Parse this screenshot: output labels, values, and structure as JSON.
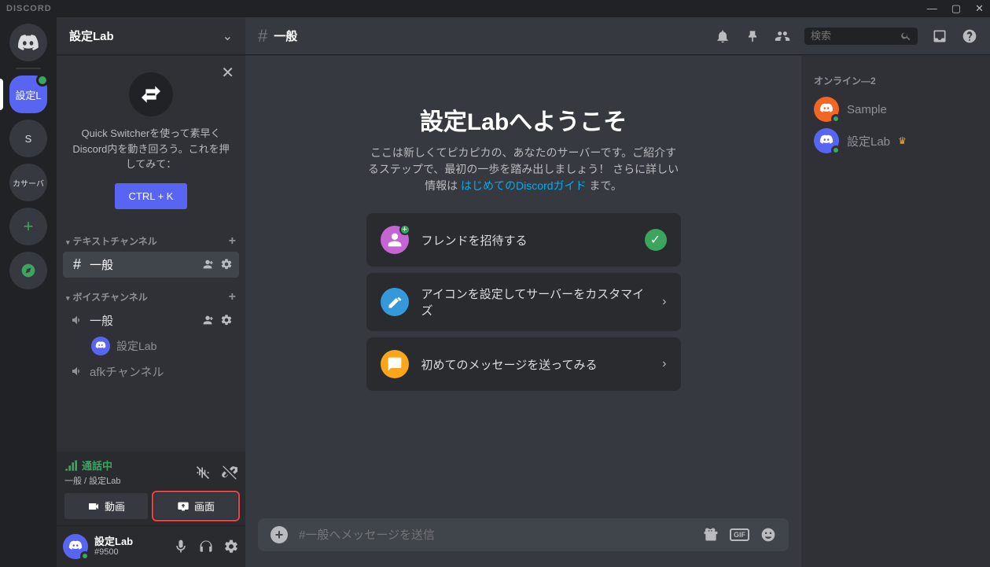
{
  "app": {
    "brand": "DISCORD"
  },
  "server": {
    "name": "設定Lab"
  },
  "quick_switcher": {
    "text": "Quick Switcherを使って素早くDiscord内を動き回ろう。これを押してみて：",
    "button": "CTRL + K"
  },
  "categories": {
    "text": {
      "label": "テキストチャンネル"
    },
    "voice": {
      "label": "ボイスチャンネル"
    }
  },
  "channels": {
    "text_general": "一般",
    "voice_general": "一般",
    "voice_afk": "afkチャンネル",
    "voice_user": "設定Lab"
  },
  "voice_panel": {
    "status": "通話中",
    "sub": "一般 / 設定Lab",
    "video": "動画",
    "screen": "画面"
  },
  "user": {
    "name": "設定Lab",
    "tag": "#9500"
  },
  "topbar": {
    "channel": "一般"
  },
  "search": {
    "placeholder": "検索"
  },
  "welcome": {
    "title": "設定Labへようこそ",
    "desc1": "ここは新しくてピカピカの、あなたのサーバーです。ご紹介するステップで、最初の一歩を踏み出しましょう！ さらに詳しい情報は ",
    "link": "はじめてのDiscordガイド",
    "desc2": " まで。"
  },
  "actions": {
    "invite": "フレンドを招待する",
    "customize": "アイコンを設定してサーバーをカスタマイズ",
    "message": "初めてのメッセージを送ってみる"
  },
  "input": {
    "placeholder": "#一般へメッセージを送信"
  },
  "members": {
    "category": "オンライン—2",
    "sample": "Sample",
    "owner": "設定Lab"
  },
  "servers": {
    "selected": "設定L",
    "s": "S",
    "discover": "カサーバ"
  }
}
